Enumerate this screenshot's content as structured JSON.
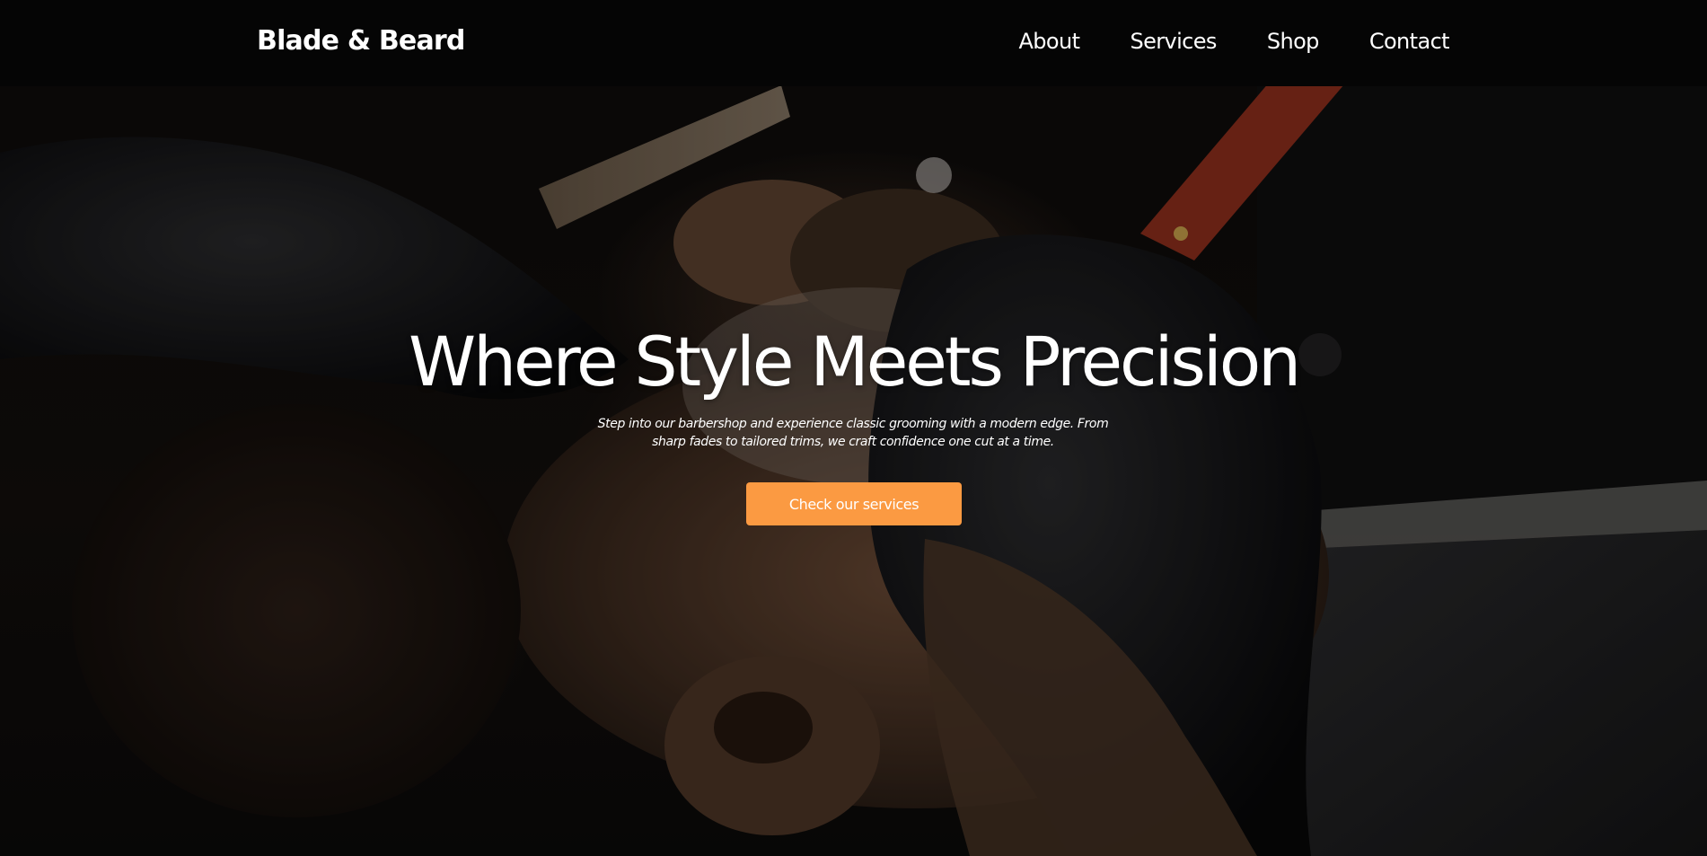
{
  "header": {
    "brand": "Blade & Beard",
    "nav": [
      {
        "label": "About"
      },
      {
        "label": "Services"
      },
      {
        "label": "Shop"
      },
      {
        "label": "Contact"
      }
    ]
  },
  "hero": {
    "title": "Where Style Meets Precision",
    "subtitle": "Step into our barbershop and experience classic grooming with a modern edge. From sharp fades to tailored trims, we craft confidence one cut at a time.",
    "cta_label": "Check our services",
    "background_image": "barber-shaving-client-photo"
  },
  "colors": {
    "header_bg": "#050505",
    "accent": "#fb9a42",
    "text": "#ffffff"
  }
}
